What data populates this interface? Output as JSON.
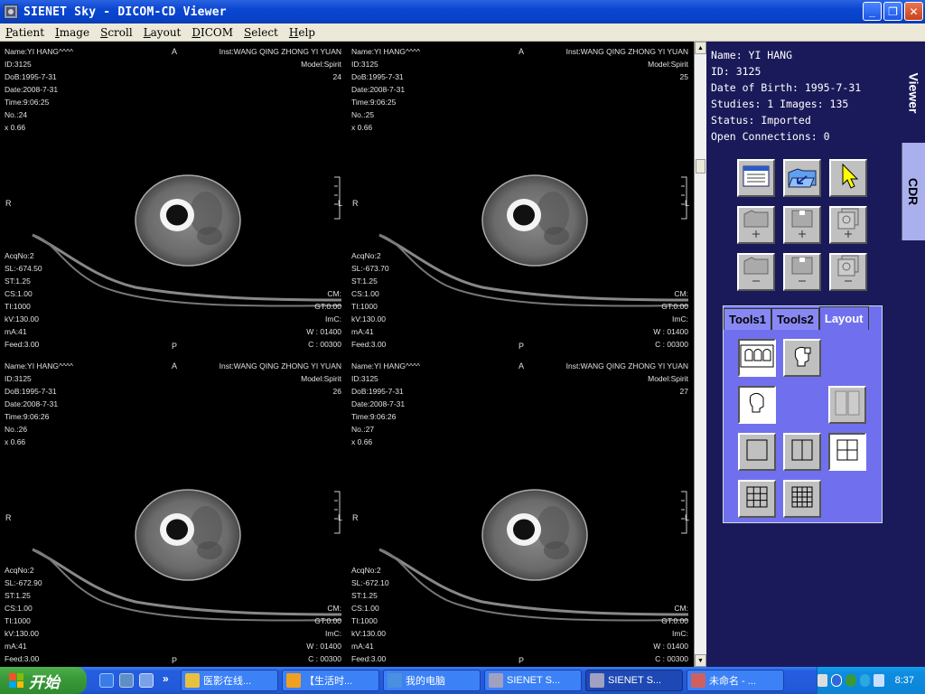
{
  "window": {
    "title": "SIENET Sky  - DICOM-CD Viewer",
    "minimize": "_",
    "maximize": "❐",
    "close": "✕"
  },
  "menu": [
    "Patient",
    "Image",
    "Scroll",
    "Layout",
    "DICOM",
    "Select",
    "Help"
  ],
  "menu_underline": [
    "P",
    "I",
    "S",
    "L",
    "D",
    "S",
    "H"
  ],
  "panes": [
    {
      "top_left": [
        "Name:YI HANG^^^^",
        "ID:3125",
        "DoB:1995-7-31",
        "Date:2008-7-31",
        "Time:9:06:25",
        "No.:24",
        "x 0.66"
      ],
      "top_right": [
        "Inst:WANG QING ZHONG YI YUAN",
        "Model:Spirit",
        "24"
      ],
      "bottom_left": [
        "AcqNo:2",
        "SL:-674.50",
        "ST:1.25",
        "CS:1.00",
        "TI:1000",
        "kV:130.00",
        "mA:41",
        "Feed:3.00"
      ],
      "bottom_right": [
        "CM:",
        "GT:0.00",
        "ImC:",
        "W : 01400",
        "C : 00300"
      ],
      "ori_top": "A",
      "ori_left": "R",
      "ori_right": "L",
      "ori_bottom": "P"
    },
    {
      "top_left": [
        "Name:YI HANG^^^^",
        "ID:3125",
        "DoB:1995-7-31",
        "Date:2008-7-31",
        "Time:9:06:25",
        "No.:25",
        "x 0.66"
      ],
      "top_right": [
        "Inst:WANG QING ZHONG YI YUAN",
        "Model:Spirit",
        "25"
      ],
      "bottom_left": [
        "AcqNo:2",
        "SL:-673.70",
        "ST:1.25",
        "CS:1.00",
        "TI:1000",
        "kV:130.00",
        "mA:41",
        "Feed:3.00"
      ],
      "bottom_right": [
        "CM:",
        "GT:0.00",
        "ImC:",
        "W : 01400",
        "C : 00300"
      ],
      "ori_top": "A",
      "ori_left": "R",
      "ori_right": "L",
      "ori_bottom": "P"
    },
    {
      "top_left": [
        "Name:YI HANG^^^^",
        "ID:3125",
        "DoB:1995-7-31",
        "Date:2008-7-31",
        "Time:9:06:26",
        "No.:26",
        "x 0.66"
      ],
      "top_right": [
        "Inst:WANG QING ZHONG YI YUAN",
        "Model:Spirit",
        "26"
      ],
      "bottom_left": [
        "AcqNo:2",
        "SL:-672.90",
        "ST:1.25",
        "CS:1.00",
        "TI:1000",
        "kV:130.00",
        "mA:41",
        "Feed:3.00"
      ],
      "bottom_right": [
        "CM:",
        "GT:0.00",
        "ImC:",
        "W : 01400",
        "C : 00300"
      ],
      "ori_top": "A",
      "ori_left": "R",
      "ori_right": "L",
      "ori_bottom": "P"
    },
    {
      "top_left": [
        "Name:YI HANG^^^^",
        "ID:3125",
        "DoB:1995-7-31",
        "Date:2008-7-31",
        "Time:9:06:26",
        "No.:27",
        "x 0.66"
      ],
      "top_right": [
        "Inst:WANG QING ZHONG YI YUAN",
        "Model:Spirit",
        "27"
      ],
      "bottom_left": [
        "AcqNo:2",
        "SL:-672.10",
        "ST:1.25",
        "CS:1.00",
        "TI:1000",
        "kV:130.00",
        "mA:41",
        "Feed:3.00"
      ],
      "bottom_right": [
        "CM:",
        "GT:0.00",
        "ImC:",
        "W : 01400",
        "C : 00300"
      ],
      "ori_top": "A",
      "ori_left": "R",
      "ori_right": "L",
      "ori_bottom": "P"
    }
  ],
  "patient_info": {
    "name": "Name:  YI HANG",
    "id": "ID:  3125",
    "dob": "Date of Birth: 1995-7-31",
    "studies": "Studies: 1 Images: 135",
    "status": "Status: Imported",
    "connections": "Open Connections: 0"
  },
  "side_tabs": {
    "viewer": "Viewer",
    "cdr": "CDR"
  },
  "tool_buttons": [
    {
      "name": "study-list-icon"
    },
    {
      "name": "open-folder-icon"
    },
    {
      "name": "pointer-icon"
    },
    {
      "name": "add-folder-icon"
    },
    {
      "name": "add-series-icon"
    },
    {
      "name": "add-image-icon"
    },
    {
      "name": "remove-folder-icon"
    },
    {
      "name": "remove-series-icon"
    },
    {
      "name": "remove-image-icon"
    }
  ],
  "toolbox": {
    "tabs": [
      "Tools1",
      "Tools2",
      "Layout"
    ],
    "active": "Layout"
  },
  "taskbar": {
    "start": "开始",
    "more": "»",
    "tasks": [
      "医影在线...",
      "【生活时...",
      "我的电脑",
      "SIENET S...",
      "SIENET S...",
      "未命名 - ..."
    ],
    "clock": "8:37"
  },
  "colors": {
    "panel_bg": "#1a1a5a",
    "toolbox_bg": "#7070ee",
    "title_blue": "#0a46d2"
  }
}
